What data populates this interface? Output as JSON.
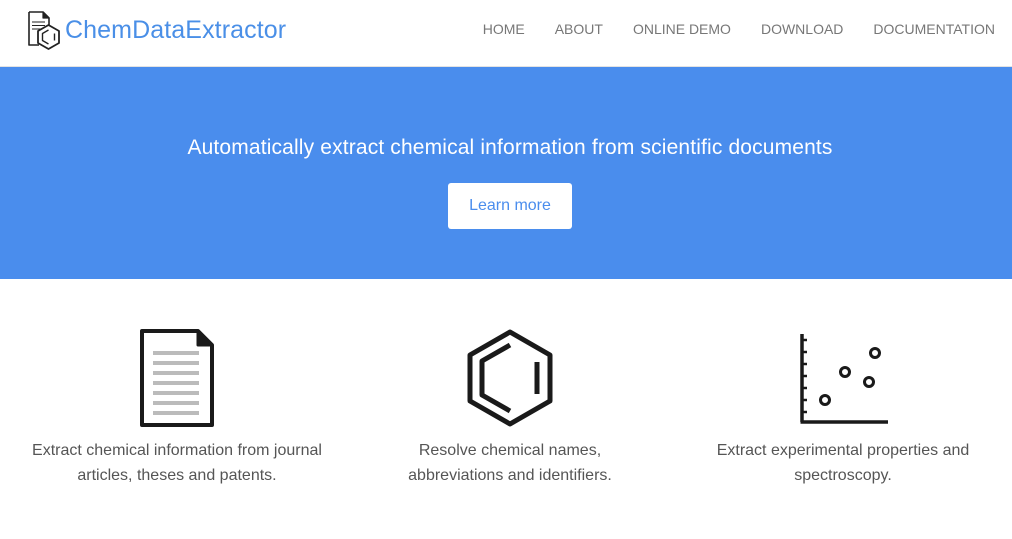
{
  "brand": {
    "name": "ChemDataExtractor",
    "logo_icon": "document-hexagon-logo-icon"
  },
  "nav": {
    "items": [
      {
        "label": "HOME"
      },
      {
        "label": "ABOUT"
      },
      {
        "label": "ONLINE DEMO"
      },
      {
        "label": "DOWNLOAD"
      },
      {
        "label": "DOCUMENTATION"
      }
    ]
  },
  "hero": {
    "title": "Automatically extract chemical information from scientific documents",
    "button_label": "Learn more",
    "background_color": "#4a8ded"
  },
  "features": [
    {
      "icon": "document-icon",
      "text": "Extract chemical information from journal articles, theses and patents."
    },
    {
      "icon": "benzene-icon",
      "text": "Resolve chemical names, abbreviations and identifiers."
    },
    {
      "icon": "scatter-plot-icon",
      "text": "Extract experimental properties and spectroscopy."
    }
  ],
  "colors": {
    "brand": "#4a8fe7",
    "nav_text": "#777777"
  }
}
